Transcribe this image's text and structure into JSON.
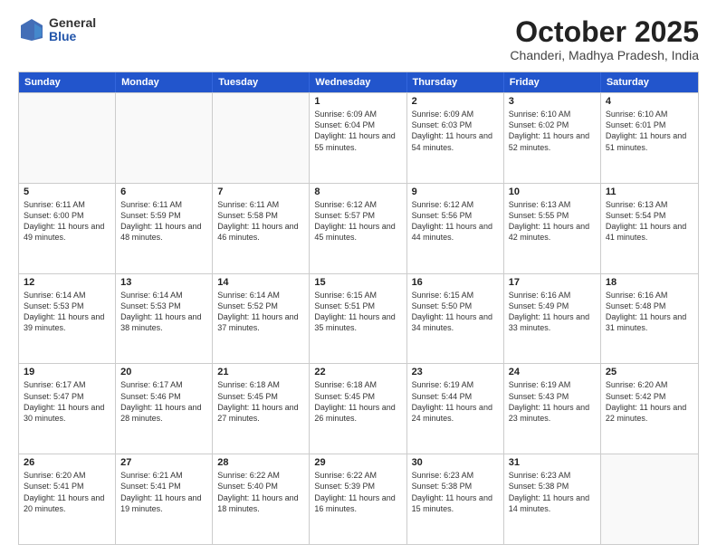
{
  "logo": {
    "general": "General",
    "blue": "Blue"
  },
  "title": {
    "month": "October 2025",
    "location": "Chanderi, Madhya Pradesh, India"
  },
  "header_days": [
    "Sunday",
    "Monday",
    "Tuesday",
    "Wednesday",
    "Thursday",
    "Friday",
    "Saturday"
  ],
  "weeks": [
    [
      {
        "day": "",
        "sunrise": "",
        "sunset": "",
        "daylight": ""
      },
      {
        "day": "",
        "sunrise": "",
        "sunset": "",
        "daylight": ""
      },
      {
        "day": "",
        "sunrise": "",
        "sunset": "",
        "daylight": ""
      },
      {
        "day": "1",
        "sunrise": "Sunrise: 6:09 AM",
        "sunset": "Sunset: 6:04 PM",
        "daylight": "Daylight: 11 hours and 55 minutes."
      },
      {
        "day": "2",
        "sunrise": "Sunrise: 6:09 AM",
        "sunset": "Sunset: 6:03 PM",
        "daylight": "Daylight: 11 hours and 54 minutes."
      },
      {
        "day": "3",
        "sunrise": "Sunrise: 6:10 AM",
        "sunset": "Sunset: 6:02 PM",
        "daylight": "Daylight: 11 hours and 52 minutes."
      },
      {
        "day": "4",
        "sunrise": "Sunrise: 6:10 AM",
        "sunset": "Sunset: 6:01 PM",
        "daylight": "Daylight: 11 hours and 51 minutes."
      }
    ],
    [
      {
        "day": "5",
        "sunrise": "Sunrise: 6:11 AM",
        "sunset": "Sunset: 6:00 PM",
        "daylight": "Daylight: 11 hours and 49 minutes."
      },
      {
        "day": "6",
        "sunrise": "Sunrise: 6:11 AM",
        "sunset": "Sunset: 5:59 PM",
        "daylight": "Daylight: 11 hours and 48 minutes."
      },
      {
        "day": "7",
        "sunrise": "Sunrise: 6:11 AM",
        "sunset": "Sunset: 5:58 PM",
        "daylight": "Daylight: 11 hours and 46 minutes."
      },
      {
        "day": "8",
        "sunrise": "Sunrise: 6:12 AM",
        "sunset": "Sunset: 5:57 PM",
        "daylight": "Daylight: 11 hours and 45 minutes."
      },
      {
        "day": "9",
        "sunrise": "Sunrise: 6:12 AM",
        "sunset": "Sunset: 5:56 PM",
        "daylight": "Daylight: 11 hours and 44 minutes."
      },
      {
        "day": "10",
        "sunrise": "Sunrise: 6:13 AM",
        "sunset": "Sunset: 5:55 PM",
        "daylight": "Daylight: 11 hours and 42 minutes."
      },
      {
        "day": "11",
        "sunrise": "Sunrise: 6:13 AM",
        "sunset": "Sunset: 5:54 PM",
        "daylight": "Daylight: 11 hours and 41 minutes."
      }
    ],
    [
      {
        "day": "12",
        "sunrise": "Sunrise: 6:14 AM",
        "sunset": "Sunset: 5:53 PM",
        "daylight": "Daylight: 11 hours and 39 minutes."
      },
      {
        "day": "13",
        "sunrise": "Sunrise: 6:14 AM",
        "sunset": "Sunset: 5:53 PM",
        "daylight": "Daylight: 11 hours and 38 minutes."
      },
      {
        "day": "14",
        "sunrise": "Sunrise: 6:14 AM",
        "sunset": "Sunset: 5:52 PM",
        "daylight": "Daylight: 11 hours and 37 minutes."
      },
      {
        "day": "15",
        "sunrise": "Sunrise: 6:15 AM",
        "sunset": "Sunset: 5:51 PM",
        "daylight": "Daylight: 11 hours and 35 minutes."
      },
      {
        "day": "16",
        "sunrise": "Sunrise: 6:15 AM",
        "sunset": "Sunset: 5:50 PM",
        "daylight": "Daylight: 11 hours and 34 minutes."
      },
      {
        "day": "17",
        "sunrise": "Sunrise: 6:16 AM",
        "sunset": "Sunset: 5:49 PM",
        "daylight": "Daylight: 11 hours and 33 minutes."
      },
      {
        "day": "18",
        "sunrise": "Sunrise: 6:16 AM",
        "sunset": "Sunset: 5:48 PM",
        "daylight": "Daylight: 11 hours and 31 minutes."
      }
    ],
    [
      {
        "day": "19",
        "sunrise": "Sunrise: 6:17 AM",
        "sunset": "Sunset: 5:47 PM",
        "daylight": "Daylight: 11 hours and 30 minutes."
      },
      {
        "day": "20",
        "sunrise": "Sunrise: 6:17 AM",
        "sunset": "Sunset: 5:46 PM",
        "daylight": "Daylight: 11 hours and 28 minutes."
      },
      {
        "day": "21",
        "sunrise": "Sunrise: 6:18 AM",
        "sunset": "Sunset: 5:45 PM",
        "daylight": "Daylight: 11 hours and 27 minutes."
      },
      {
        "day": "22",
        "sunrise": "Sunrise: 6:18 AM",
        "sunset": "Sunset: 5:45 PM",
        "daylight": "Daylight: 11 hours and 26 minutes."
      },
      {
        "day": "23",
        "sunrise": "Sunrise: 6:19 AM",
        "sunset": "Sunset: 5:44 PM",
        "daylight": "Daylight: 11 hours and 24 minutes."
      },
      {
        "day": "24",
        "sunrise": "Sunrise: 6:19 AM",
        "sunset": "Sunset: 5:43 PM",
        "daylight": "Daylight: 11 hours and 23 minutes."
      },
      {
        "day": "25",
        "sunrise": "Sunrise: 6:20 AM",
        "sunset": "Sunset: 5:42 PM",
        "daylight": "Daylight: 11 hours and 22 minutes."
      }
    ],
    [
      {
        "day": "26",
        "sunrise": "Sunrise: 6:20 AM",
        "sunset": "Sunset: 5:41 PM",
        "daylight": "Daylight: 11 hours and 20 minutes."
      },
      {
        "day": "27",
        "sunrise": "Sunrise: 6:21 AM",
        "sunset": "Sunset: 5:41 PM",
        "daylight": "Daylight: 11 hours and 19 minutes."
      },
      {
        "day": "28",
        "sunrise": "Sunrise: 6:22 AM",
        "sunset": "Sunset: 5:40 PM",
        "daylight": "Daylight: 11 hours and 18 minutes."
      },
      {
        "day": "29",
        "sunrise": "Sunrise: 6:22 AM",
        "sunset": "Sunset: 5:39 PM",
        "daylight": "Daylight: 11 hours and 16 minutes."
      },
      {
        "day": "30",
        "sunrise": "Sunrise: 6:23 AM",
        "sunset": "Sunset: 5:38 PM",
        "daylight": "Daylight: 11 hours and 15 minutes."
      },
      {
        "day": "31",
        "sunrise": "Sunrise: 6:23 AM",
        "sunset": "Sunset: 5:38 PM",
        "daylight": "Daylight: 11 hours and 14 minutes."
      },
      {
        "day": "",
        "sunrise": "",
        "sunset": "",
        "daylight": ""
      }
    ]
  ]
}
